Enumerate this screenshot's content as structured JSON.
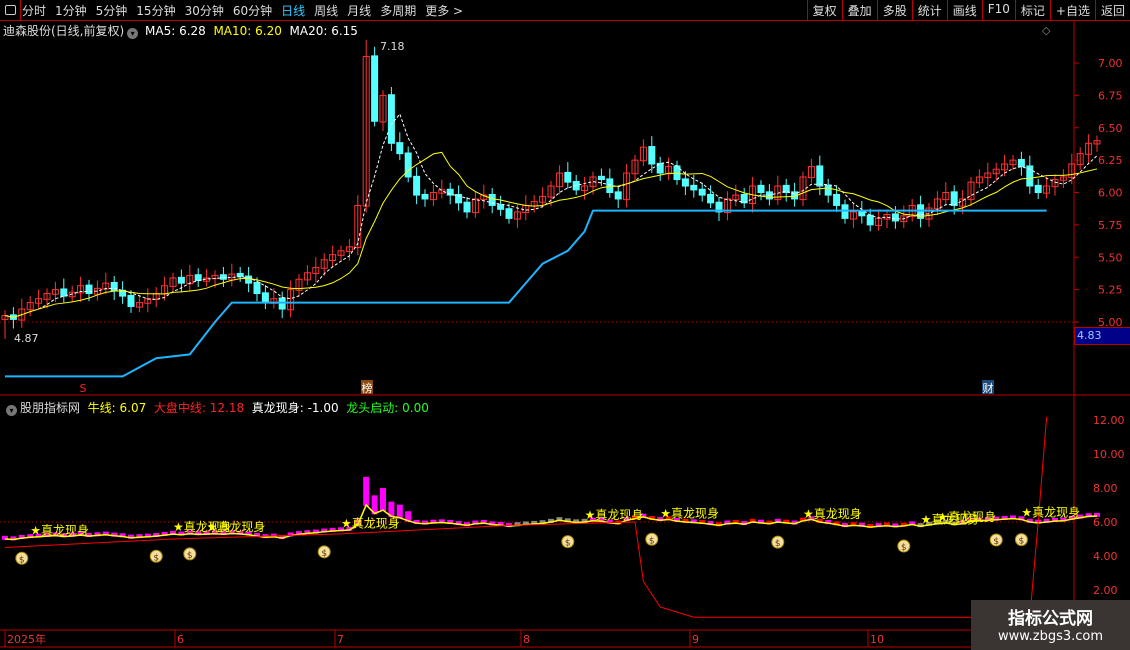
{
  "toolbar": {
    "tabs": [
      "分时",
      "1分钟",
      "5分钟",
      "15分钟",
      "30分钟",
      "60分钟",
      "日线",
      "周线",
      "月线",
      "多周期",
      "更多 >"
    ],
    "active": "日线",
    "right": [
      "复权",
      "叠加",
      "多股",
      "统计",
      "画线",
      "F10",
      "标记",
      "+自选",
      "返回"
    ]
  },
  "main": {
    "title": "迪森股份(日线,前复权)",
    "ma5": "MA5: 6.28",
    "ma10": "MA10: 6.20",
    "ma20": "MA20: 6.15",
    "high_label": "7.18",
    "low_label": "4.87",
    "current_price": "4.83",
    "markers": [
      "S",
      "榜",
      "财"
    ]
  },
  "indicator": {
    "name": "股朋指标网",
    "niu": "牛线: 6.07",
    "dapan": "大盘中线: 12.18",
    "zhenlong": "真龙现身: -1.00",
    "longtou": "龙头启动: 0.00",
    "signal_label": "真龙现身"
  },
  "colors": {
    "up": "#ff3232",
    "down": "#54ffff",
    "ma5": "#ffffff",
    "ma10": "#ffff00",
    "support": "#1eb4ff",
    "bars": "#ff00ff",
    "red_line": "#ff0000"
  },
  "watermark": {
    "title": "指标公式网",
    "url": "www.zbgs3.com"
  },
  "chart_data": [
    {
      "type": "candlestick",
      "price_axis": [
        "7.00",
        "6.75",
        "6.50",
        "6.25",
        "6.00",
        "5.75",
        "5.50",
        "5.25",
        "5.00"
      ],
      "x_ticks": [
        "2025年",
        "6",
        "7",
        "8",
        "9",
        "10"
      ],
      "closes": [
        5.05,
        5.02,
        5.1,
        5.15,
        5.18,
        5.22,
        5.25,
        5.2,
        5.23,
        5.28,
        5.22,
        5.26,
        5.3,
        5.24,
        5.2,
        5.12,
        5.15,
        5.18,
        5.22,
        5.28,
        5.34,
        5.3,
        5.36,
        5.32,
        5.34,
        5.36,
        5.33,
        5.37,
        5.35,
        5.3,
        5.22,
        5.15,
        5.18,
        5.1,
        5.25,
        5.33,
        5.38,
        5.42,
        5.48,
        5.52,
        5.55,
        5.58,
        5.9,
        7.05,
        6.55,
        6.75,
        6.38,
        6.3,
        6.12,
        5.98,
        5.95,
        6.0,
        6.02,
        5.98,
        5.92,
        5.85,
        5.95,
        5.98,
        5.9,
        5.87,
        5.8,
        5.85,
        5.9,
        5.93,
        5.97,
        6.05,
        6.15,
        6.08,
        6.02,
        6.05,
        6.12,
        6.1,
        6.0,
        5.95,
        6.15,
        6.25,
        6.35,
        6.22,
        6.15,
        6.2,
        6.1,
        6.05,
        6.02,
        5.98,
        5.92,
        5.85,
        5.95,
        5.98,
        5.92,
        6.05,
        6.0,
        5.95,
        6.05,
        6.0,
        5.95,
        6.12,
        6.2,
        6.05,
        5.98,
        5.9,
        5.8,
        5.85,
        5.82,
        5.75,
        5.8,
        5.83,
        5.78,
        5.82,
        5.9,
        5.8,
        5.88,
        5.95,
        6.0,
        5.9,
        5.95,
        6.08,
        6.12,
        6.15,
        6.18,
        6.22,
        6.25,
        6.2,
        6.05,
        6.0,
        6.05,
        6.1,
        6.12,
        6.22,
        6.3,
        6.38,
        6.4
      ],
      "support_steps": [
        [
          0,
          4.58
        ],
        [
          14,
          4.58
        ],
        [
          18,
          4.72
        ],
        [
          22,
          4.75
        ],
        [
          25,
          5.0
        ],
        [
          27,
          5.15
        ],
        [
          60,
          5.15
        ],
        [
          62,
          5.3
        ],
        [
          64,
          5.45
        ],
        [
          67,
          5.55
        ],
        [
          69,
          5.7
        ],
        [
          70,
          5.86
        ],
        [
          124,
          5.86
        ]
      ]
    },
    {
      "type": "indicator",
      "y_axis": [
        "12.00",
        "10.00",
        "8.00",
        "6.00",
        "4.00",
        "2.00"
      ],
      "red_line": [
        [
          0,
          4.5
        ],
        [
          20,
          5.0
        ],
        [
          40,
          5.3
        ],
        [
          60,
          5.8
        ],
        [
          75,
          6.0
        ],
        [
          76,
          2.5
        ],
        [
          78,
          1.0
        ],
        [
          82,
          0.4
        ],
        [
          122,
          0.4
        ],
        [
          123,
          6
        ],
        [
          124,
          12.18
        ]
      ],
      "signal_indices": [
        3,
        20,
        24,
        40,
        69,
        78,
        95,
        109,
        111,
        121
      ],
      "bag_indices": [
        2,
        18,
        22,
        38,
        67,
        77,
        92,
        107,
        118,
        121
      ]
    }
  ]
}
